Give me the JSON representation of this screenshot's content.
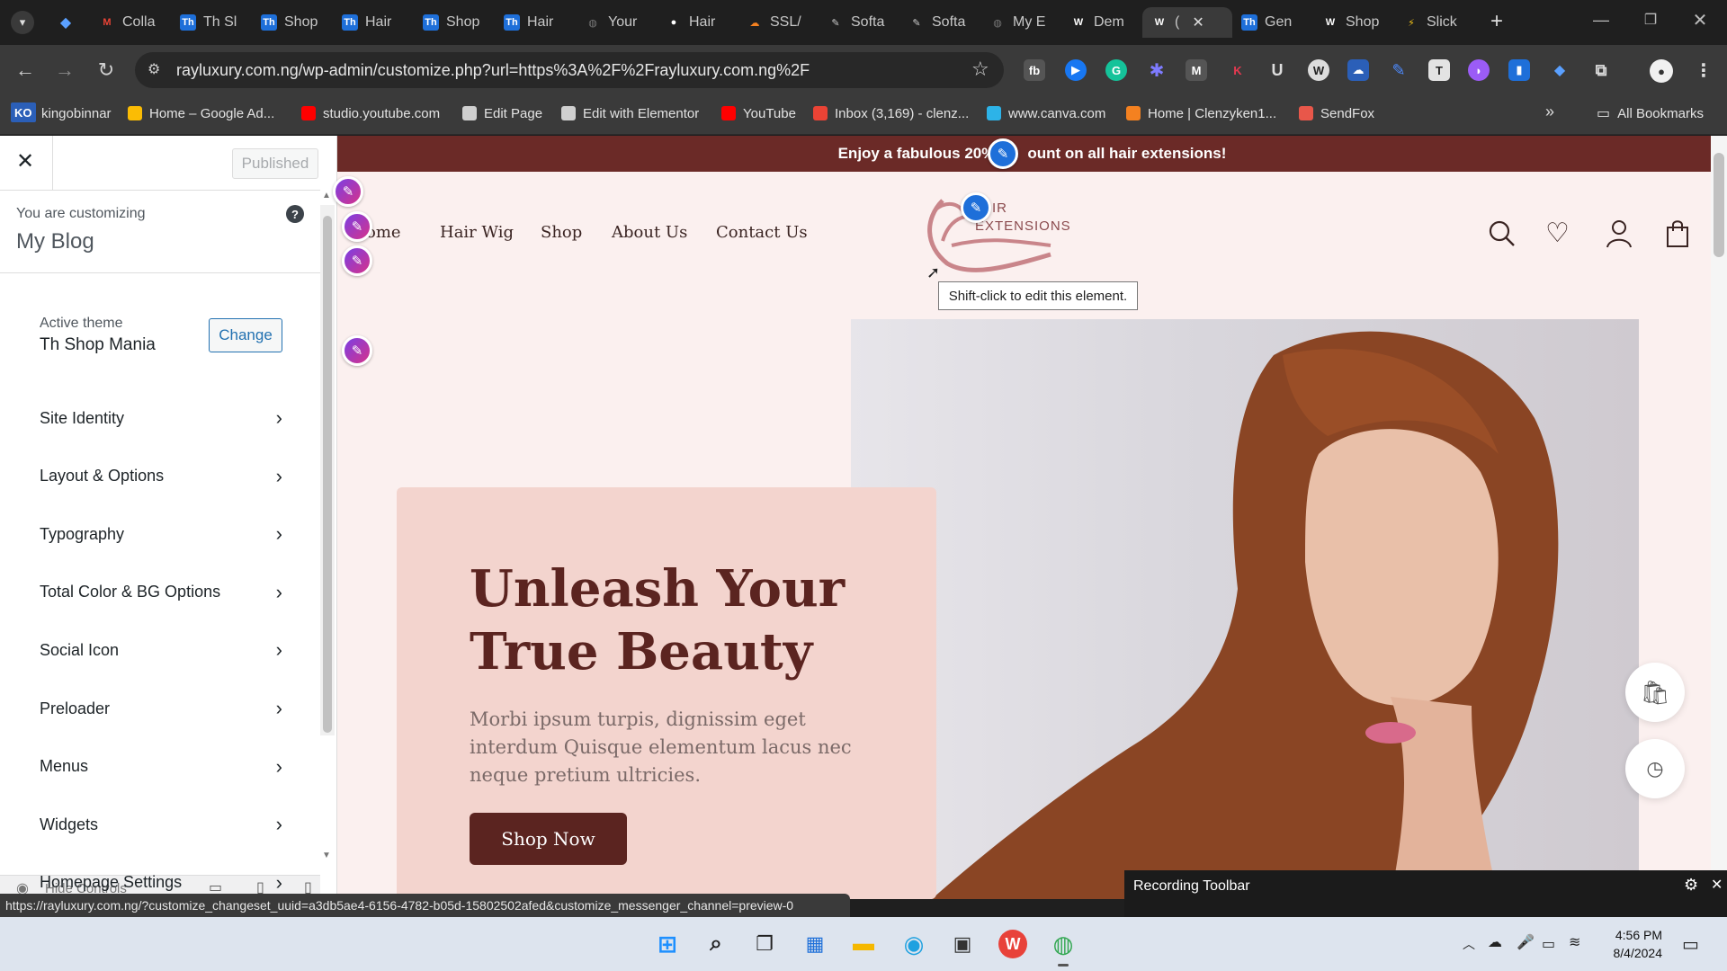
{
  "browser": {
    "tabs": [
      {
        "label": "Colla",
        "icon": "gmail-icon",
        "color": "#ea4335",
        "glyph": "M"
      },
      {
        "label": "Th Sl",
        "icon": "th-icon",
        "color": "#1e6fd9",
        "glyph": "Th"
      },
      {
        "label": "Shop",
        "icon": "th-icon",
        "color": "#1e6fd9",
        "glyph": "Th"
      },
      {
        "label": "Hair",
        "icon": "th-icon",
        "color": "#1e6fd9",
        "glyph": "Th"
      },
      {
        "label": "Shop",
        "icon": "th-icon",
        "color": "#1e6fd9",
        "glyph": "Th"
      },
      {
        "label": "Hair",
        "icon": "th-icon",
        "color": "#1e6fd9",
        "glyph": "Th"
      },
      {
        "label": "Your",
        "icon": "globe-icon",
        "color": "#777777",
        "glyph": "◍"
      },
      {
        "label": "Hair",
        "icon": "globe-icon",
        "color": "#ffffff",
        "glyph": "●"
      },
      {
        "label": "SSL/",
        "icon": "cloudflare-icon",
        "color": "#f48120",
        "glyph": "☁"
      },
      {
        "label": "Softa",
        "icon": "doc-icon",
        "color": "#cccccc",
        "glyph": "✎"
      },
      {
        "label": "Softa",
        "icon": "doc-icon",
        "color": "#cccccc",
        "glyph": "✎"
      },
      {
        "label": "My E",
        "icon": "globe-icon",
        "color": "#777777",
        "glyph": "◍"
      },
      {
        "label": "Dem",
        "icon": "wordpress-icon",
        "color": "#ffffff",
        "glyph": "W"
      },
      {
        "label": "(",
        "icon": "wordpress-icon",
        "color": "#ffffff",
        "glyph": "W",
        "active": true
      },
      {
        "label": "Gen",
        "icon": "th-icon",
        "color": "#1e6fd9",
        "glyph": "Th"
      },
      {
        "label": "Shop",
        "icon": "wordpress-icon",
        "color": "#ffffff",
        "glyph": "W"
      },
      {
        "label": "Slick",
        "icon": "slick-icon",
        "color": "#f5c518",
        "glyph": "⚡"
      }
    ],
    "new_tab_label": "+",
    "url": "rayluxury.com.ng/wp-admin/customize.php?url=https%3A%2F%2Frayluxury.com.ng%2F",
    "bookmarks": [
      {
        "label": "kingobinnar",
        "color": "#2b5fb8"
      },
      {
        "label": "Home – Google Ad...",
        "color": "#fbbc04"
      },
      {
        "label": "studio.youtube.com",
        "color": "#ff0000"
      },
      {
        "label": "Edit Page",
        "color": "#cfcfcf"
      },
      {
        "label": "Edit with Elementor",
        "color": "#cfcfcf"
      },
      {
        "label": "YouTube",
        "color": "#ff0000"
      },
      {
        "label": "Inbox (3,169) - clenz...",
        "color": "#ea4335"
      },
      {
        "label": "www.canva.com",
        "color": "#2db3e8"
      },
      {
        "label": "Home | Clenzyken1...",
        "color": "#f48120"
      },
      {
        "label": "SendFox",
        "color": "#e8574a"
      }
    ],
    "bookmark_badge": "KO",
    "all_bookmarks_label": "All Bookmarks",
    "status_url": "https://rayluxury.com.ng/?customize_changeset_uuid=a3db5ae4-6156-4782-b05d-15802502afed&customize_messenger_channel=preview-0"
  },
  "customizer": {
    "publish_label": "Published",
    "customizing_label": "You are customizing",
    "site_name": "My Blog",
    "active_theme_label": "Active theme",
    "theme_name": "Th Shop Mania",
    "change_label": "Change",
    "sections": [
      "Site Identity",
      "Layout & Options",
      "Typography",
      "Total Color & BG Options",
      "Social Icon",
      "Preloader",
      "Menus",
      "Widgets",
      "Homepage Settings"
    ],
    "hide_controls_label": "Hide Controls"
  },
  "site": {
    "announcement": "Enjoy a fabulous 20% discount on all hair extensions!",
    "announcement_left": "Enjoy a fabulous 20%",
    "announcement_right": "ount on all hair extensions!",
    "nav": [
      "ome",
      "Hair Wig",
      "Shop",
      "About Us",
      "Contact Us"
    ],
    "logo_line1": "IR",
    "logo_line2": "EXTENSIONS",
    "tooltip": "Shift-click to edit this element.",
    "hero_title_line1": "Unleash Your",
    "hero_title_line2": "True Beauty",
    "hero_subtitle": "Morbi ipsum turpis, dignissim eget interdum Quisque elementum lacus nec neque pretium ultricies.",
    "cta_label": "Shop Now",
    "brand_color": "#5b2420",
    "announce_color": "#6b2a27",
    "card_color": "#f3d4ce"
  },
  "recording_toolbar": {
    "title": "Recording Toolbar"
  },
  "taskbar": {
    "time": "4:56 PM",
    "date": "8/4/2024"
  }
}
